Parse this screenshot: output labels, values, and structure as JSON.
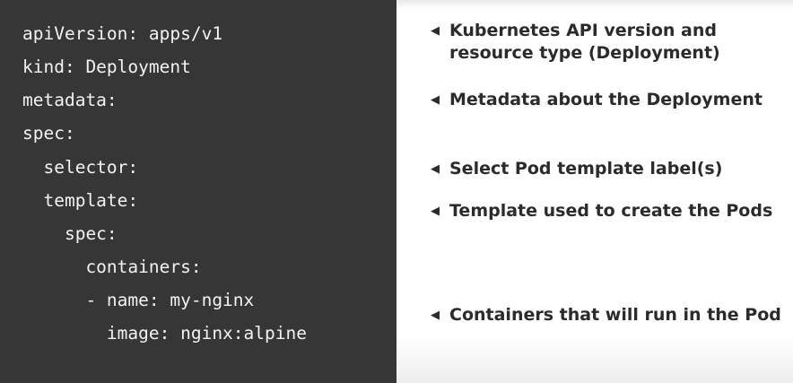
{
  "code": {
    "lines": [
      "apiVersion: apps/v1",
      "kind: Deployment",
      "metadata:",
      "spec:",
      "  selector:",
      "  template:",
      "    spec:",
      "      containers:",
      "      - name: my-nginx",
      "        image: nginx:alpine"
    ]
  },
  "notes": {
    "arrow_glyph": "◀",
    "items": [
      "Kubernetes API version and resource type (Deployment)",
      "Metadata about the Deployment",
      "Select Pod template label(s)",
      "Template used to create the Pods",
      "Containers that will run in the Pod"
    ]
  },
  "colors": {
    "code_background": "#363636",
    "code_text": "#f2f2f2",
    "notes_background": "#ffffff",
    "notes_text": "#2b2b2b"
  }
}
